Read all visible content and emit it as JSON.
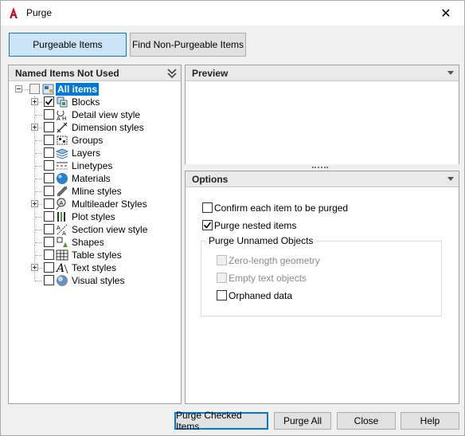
{
  "window": {
    "title": "Purge",
    "close_glyph": "✕"
  },
  "tabs": {
    "purgeable": "Purgeable Items",
    "non_purgeable": "Find Non-Purgeable Items"
  },
  "left_panel": {
    "header": "Named Items Not Used"
  },
  "tree": {
    "root": "All items",
    "items": [
      {
        "label": "Blocks",
        "icon": "blocks-icon",
        "expandable": true,
        "checked": true
      },
      {
        "label": "Detail view style",
        "icon": "detail-view-icon",
        "expandable": false,
        "checked": false
      },
      {
        "label": "Dimension styles",
        "icon": "dimension-icon",
        "expandable": true,
        "checked": false
      },
      {
        "label": "Groups",
        "icon": "groups-icon",
        "expandable": false,
        "checked": false
      },
      {
        "label": "Layers",
        "icon": "layers-icon",
        "expandable": false,
        "checked": false
      },
      {
        "label": "Linetypes",
        "icon": "linetypes-icon",
        "expandable": false,
        "checked": false
      },
      {
        "label": "Materials",
        "icon": "materials-icon",
        "expandable": false,
        "checked": false
      },
      {
        "label": "Mline styles",
        "icon": "mline-icon",
        "expandable": false,
        "checked": false
      },
      {
        "label": "Multileader Styles",
        "icon": "multileader-icon",
        "expandable": true,
        "checked": false
      },
      {
        "label": "Plot styles",
        "icon": "plot-styles-icon",
        "expandable": false,
        "checked": false
      },
      {
        "label": "Section view style",
        "icon": "section-view-icon",
        "expandable": false,
        "checked": false
      },
      {
        "label": "Shapes",
        "icon": "shapes-icon",
        "expandable": false,
        "checked": false
      },
      {
        "label": "Table styles",
        "icon": "table-icon",
        "expandable": false,
        "checked": false
      },
      {
        "label": "Text styles",
        "icon": "text-styles-icon",
        "expandable": true,
        "checked": false
      },
      {
        "label": "Visual styles",
        "icon": "visual-styles-icon",
        "expandable": false,
        "checked": false
      }
    ]
  },
  "preview": {
    "header": "Preview"
  },
  "options": {
    "header": "Options",
    "confirm_each": {
      "label": "Confirm each item to be purged",
      "checked": false
    },
    "purge_nested": {
      "label": "Purge nested items",
      "checked": true
    },
    "unnamed_group": {
      "title": "Purge Unnamed Objects",
      "zero_length": {
        "label": "Zero-length geometry",
        "enabled": false
      },
      "empty_text": {
        "label": "Empty text objects",
        "enabled": false
      },
      "orphaned": {
        "label": "Orphaned data",
        "enabled": true
      }
    }
  },
  "buttons": {
    "purge_checked": "Purge Checked Items",
    "purge_all": "Purge All",
    "close": "Close",
    "help": "Help"
  },
  "colors": {
    "accent": "#0078d7",
    "selection": "#0078d7",
    "title_icon": "#c8102e"
  }
}
